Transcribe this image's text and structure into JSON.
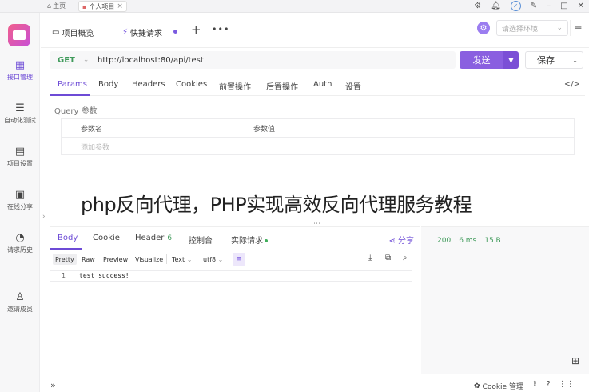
{
  "titlebar": {
    "home_label": "主页",
    "tab_label": "个人项目",
    "tab_close": "×",
    "icons": [
      "gear-icon",
      "bell-icon",
      "check-icon",
      "pin-icon",
      "minimize-icon",
      "maximize-icon",
      "close-icon"
    ]
  },
  "sidebar": {
    "items": [
      {
        "label": "接口管理",
        "icon": "api-icon",
        "active": true
      },
      {
        "label": "自动化测试",
        "icon": "automation-icon",
        "active": false
      },
      {
        "label": "项目设置",
        "icon": "settings-icon",
        "active": false
      },
      {
        "label": "在线分享",
        "icon": "share-icon",
        "active": false
      },
      {
        "label": "请求历史",
        "icon": "history-icon",
        "active": false
      },
      {
        "label": "邀请成员",
        "icon": "invite-icon",
        "active": false
      }
    ]
  },
  "workspace": {
    "tabs": [
      {
        "label": "项目概览"
      },
      {
        "label": "快捷请求"
      }
    ],
    "env_placeholder": "请选择环境"
  },
  "request": {
    "method": "GET",
    "url": "http://localhost:80/api/test",
    "send_label": "发送",
    "save_label": "保存",
    "tabs": [
      "Params",
      "Body",
      "Headers",
      "Cookies",
      "前置操作",
      "后置操作",
      "Auth",
      "设置"
    ],
    "active_tab": "Params",
    "query_label": "Query 参数",
    "param_name_header": "参数名",
    "param_value_header": "参数值",
    "add_param_placeholder": "添加参数"
  },
  "overlay_title": "php反向代理，PHP实现高效反向代理服务教程",
  "response": {
    "tabs": [
      {
        "label": "Body",
        "count": ""
      },
      {
        "label": "Cookie",
        "count": ""
      },
      {
        "label": "Header",
        "count": "6"
      },
      {
        "label": "控制台",
        "count": ""
      },
      {
        "label": "实际请求",
        "count": ""
      }
    ],
    "share_label": "分享",
    "view_options": [
      "Pretty",
      "Raw",
      "Preview",
      "Visualize"
    ],
    "format": "Text",
    "encoding": "utf8",
    "code_lines": [
      {
        "no": "1",
        "text": "test success!"
      }
    ],
    "status": {
      "code": "200",
      "time": "6 ms",
      "size": "15 B"
    }
  },
  "bottombar": {
    "cookie_label": "Cookie 管理"
  },
  "colors": {
    "accent": "#8a5fe0",
    "success": "#3f9a5a"
  }
}
